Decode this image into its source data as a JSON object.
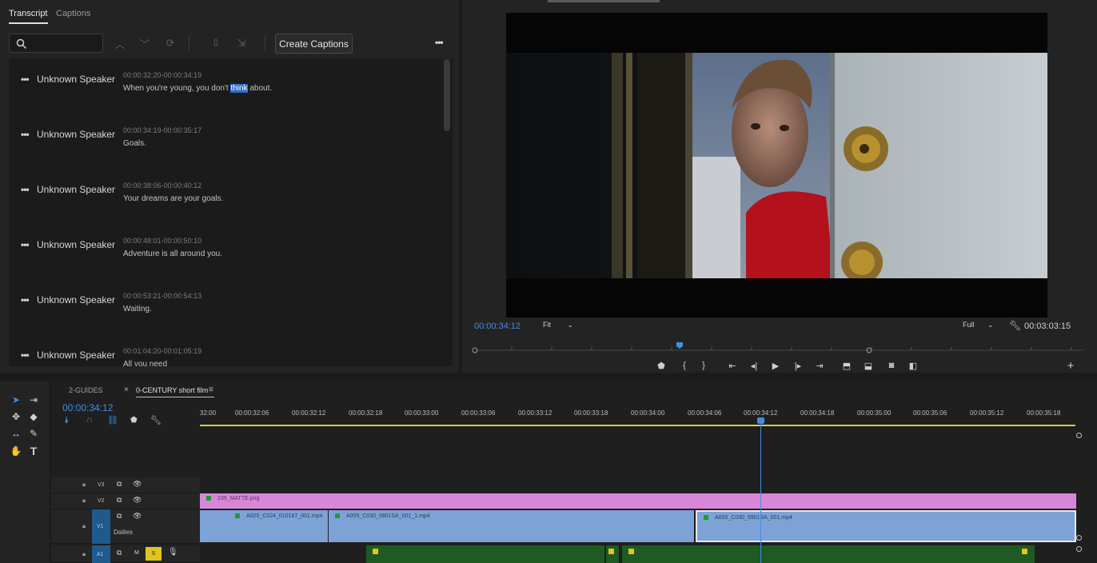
{
  "transcript": {
    "tabs": [
      "Transcript",
      "Captions"
    ],
    "create_captions_label": "Create Captions",
    "more_label": "•••",
    "entries": [
      {
        "speaker": "Unknown Speaker",
        "timecode": "00:00:32:20-00:00:34:19",
        "text_before": "When you're young, you don't ",
        "highlight": "think",
        "text_after": " about."
      },
      {
        "speaker": "Unknown Speaker",
        "timecode": "00:00:34:19-00:00:35:17",
        "text": "Goals."
      },
      {
        "speaker": "Unknown Speaker",
        "timecode": "00:00:38:06-00:00:40:12",
        "text": "Your dreams are your goals."
      },
      {
        "speaker": "Unknown Speaker",
        "timecode": "00:00:48:01-00:00:50:10",
        "text": "Adventure is all around you."
      },
      {
        "speaker": "Unknown Speaker",
        "timecode": "00:00:53:21-00:00:54:13",
        "text": "Waiting."
      },
      {
        "speaker": "Unknown Speaker",
        "timecode": "00:01:04:20-00:01:05:19",
        "text": "All you need"
      }
    ]
  },
  "program": {
    "timecode": "00:00:34:12",
    "fit_label": "Fit",
    "full_label": "Full",
    "duration": "00:03:03:15"
  },
  "timeline": {
    "tabs": [
      "2-GUIDES",
      "0-CENTURY short film"
    ],
    "timecode": "00:00:34:12",
    "ruler_labels": [
      "32:00",
      "00:00:32:06",
      "00:00:32:12",
      "00:00:32:18",
      "00:00:33:00",
      "00:00:33:06",
      "00:00:33:12",
      "00:00:33:18",
      "00:00:34:00",
      "00:00:34:06",
      "00:00:34:12",
      "00:00:34:18",
      "00:00:35:00",
      "00:00:35:06",
      "00:00:35:12",
      "00:00:35:18"
    ],
    "tracks": {
      "v3": "V3",
      "v2": "V2",
      "v1": "V1",
      "v1_name": "Dailies",
      "a1": "A1",
      "m": "M",
      "s": "S"
    },
    "clips": {
      "v2": "239_MATTE.png",
      "v1a": "A025_C024_010167_001.mp4",
      "v1b": "A005_C030_0901SA_001_1.mp4",
      "v1c": "A005_C030_0901SA_001.mp4"
    }
  },
  "colors": {
    "accent": "#3e8ee8",
    "matte_clip": "#d887d8",
    "video_clip": "#7da3d6",
    "audio_clip": "#1e5a22",
    "work_area": "#d6d23a"
  }
}
